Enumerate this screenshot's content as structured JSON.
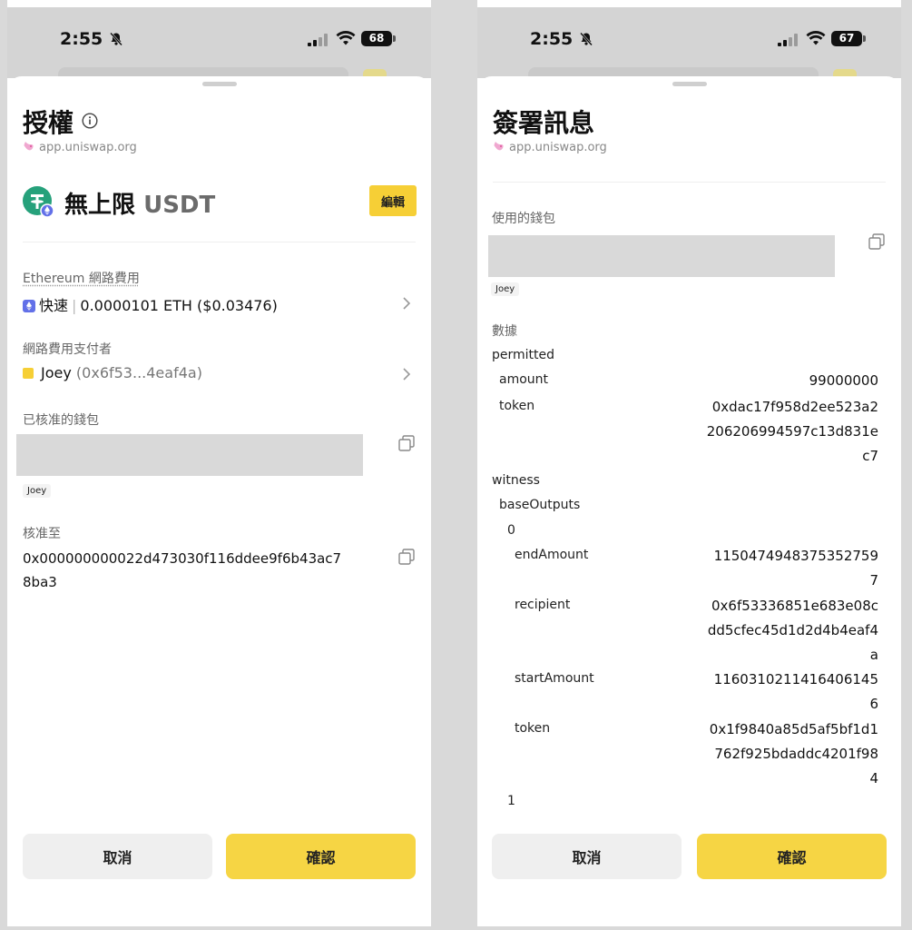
{
  "left": {
    "status": {
      "time": "2:55",
      "battery": "68"
    },
    "title": "授權",
    "site": "app.uniswap.org",
    "token": {
      "amount": "無上限",
      "symbol": "USDT",
      "edit_label": "編輯"
    },
    "fee": {
      "label": "Ethereum 網路費用",
      "speed": "快速",
      "sep": "|",
      "value": "0.0000101 ETH ($0.03476)"
    },
    "payer": {
      "label": "網路費用支付者",
      "name": "Joey",
      "address": "(0x6f53...4eaf4a)"
    },
    "approved_wallet": {
      "label": "已核准的錢包",
      "tag": "Joey"
    },
    "approve_to": {
      "label": "核准至",
      "address": "0x000000000022d473030f116ddee9f6b43ac78ba3"
    },
    "buttons": {
      "cancel": "取消",
      "confirm": "確認"
    }
  },
  "right": {
    "status": {
      "time": "2:55",
      "battery": "67"
    },
    "title": "簽署訊息",
    "site": "app.uniswap.org",
    "wallet": {
      "label": "使用的錢包",
      "tag": "Joey"
    },
    "data_label": "數據",
    "fields": {
      "permitted": "permitted",
      "amount_key": "amount",
      "amount_val": "99000000",
      "token_key": "token",
      "token_val": "0xdac17f958d2ee523a2206206994597c13d831ec7",
      "witness": "witness",
      "baseOutputs": "baseOutputs",
      "idx0": "0",
      "endAmount_key": "endAmount",
      "endAmount_val": "11504749483753527597",
      "recipient_key": "recipient",
      "recipient_val": "0x6f53336851e683e08cdd5cfec45d1d2d4b4eaf4a",
      "startAmount_key": "startAmount",
      "startAmount_val": "11603102114164061456",
      "token2_key": "token",
      "token2_val": "0x1f9840a85d5af5bf1d1762f925bdaddc4201f984",
      "idx1": "1"
    },
    "buttons": {
      "cancel": "取消",
      "confirm": "確認"
    }
  }
}
